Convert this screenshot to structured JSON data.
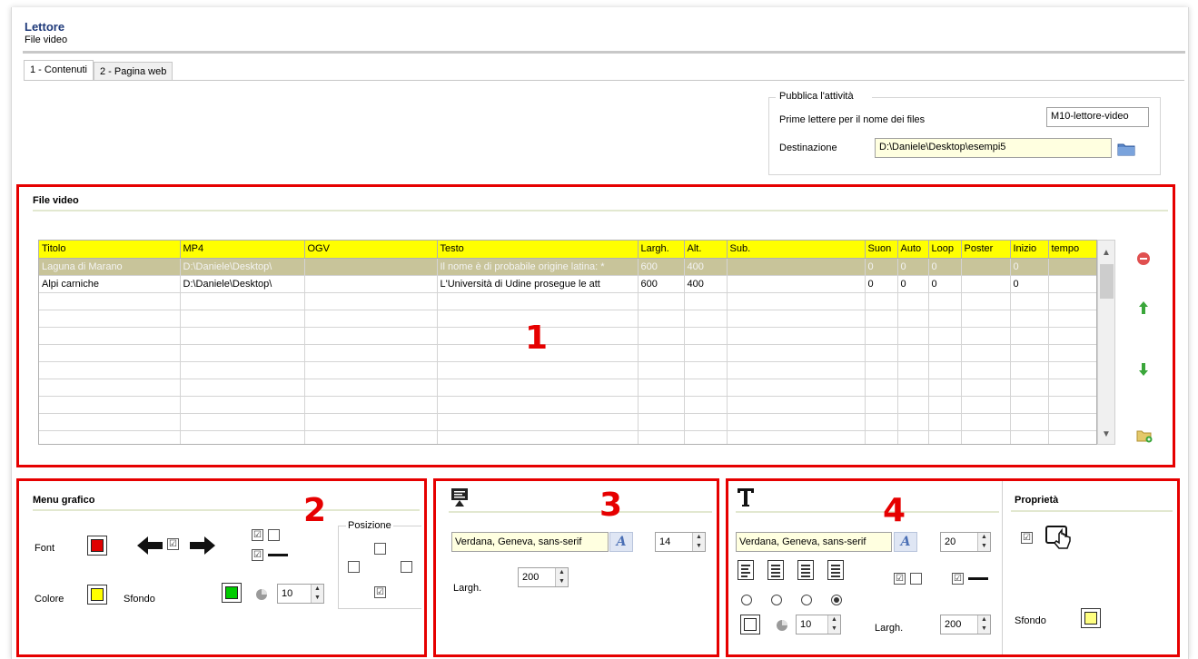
{
  "app": {
    "title": "Lettore",
    "subtitle": "File video"
  },
  "tabs": [
    {
      "label": "1 - Contenuti"
    },
    {
      "label": "2 - Pagina web"
    }
  ],
  "publish": {
    "legend": "Pubblica l'attività",
    "prefix_label": "Prime lettere per il nome dei files",
    "prefix_value": "M10-lettore-video",
    "dest_label": "Destinazione",
    "dest_value": "D:\\Daniele\\Desktop\\esempi5"
  },
  "video_section": {
    "title": "File video",
    "columns": [
      "Titolo",
      "MP4",
      "OGV",
      "Testo",
      "Largh.",
      "Alt.",
      "Sub.",
      "Suon",
      "Auto",
      "Loop",
      "Poster",
      "Inizio",
      "tempo"
    ],
    "rows": [
      [
        "Laguna di Marano",
        "D:\\Daniele\\Desktop\\",
        "",
        "Il nome è di probabile origine latina: *",
        "600",
        "400",
        "",
        "0",
        "0",
        "0",
        "",
        "0",
        ""
      ],
      [
        "Alpi carniche",
        "D:\\Daniele\\Desktop\\",
        "",
        "L'Università di Udine prosegue le att",
        "600",
        "400",
        "",
        "0",
        "0",
        "0",
        "",
        "0",
        ""
      ]
    ],
    "empty_rows": 9,
    "selected_row": 0
  },
  "annotations": {
    "n1": "1",
    "n2": "2",
    "n3": "3",
    "n4": "4"
  },
  "menu_grafico": {
    "title": "Menu grafico",
    "font_label": "Font",
    "colore_label": "Colore",
    "sfondo_label": "Sfondo",
    "posizione_label": "Posizione",
    "font_color": "#e00000",
    "colore_color": "#ffff00",
    "sfondo_color": "#00cc00",
    "radius_value": "10"
  },
  "panel3": {
    "font_value": "Verdana, Geneva, sans-serif",
    "size_value": "14",
    "largh_label": "Largh.",
    "largh_value": "200"
  },
  "panel4": {
    "font_value": "Verdana, Geneva, sans-serif",
    "size_value": "20",
    "radius_value": "10",
    "largh_label": "Largh.",
    "largh_value": "200"
  },
  "proprieta": {
    "title": "Proprietà",
    "sfondo_label": "Sfondo",
    "sfondo_color": "#ffff80"
  }
}
